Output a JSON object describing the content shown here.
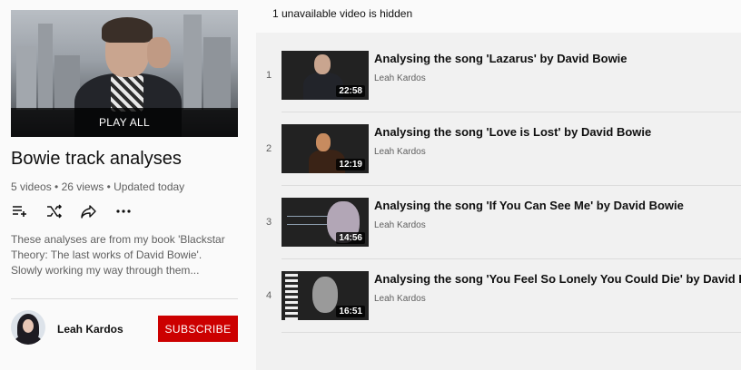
{
  "playlist": {
    "play_all_label": "PLAY ALL",
    "title": "Bowie track analyses",
    "meta": "5 videos • 26 views • Updated today",
    "description": "These analyses are from my book 'Blackstar Theory: The last works of David Bowie'. Slowly working my way through them...",
    "actions": [
      {
        "icon": "add-to-queue-icon"
      },
      {
        "icon": "shuffle-icon"
      },
      {
        "icon": "share-icon"
      },
      {
        "icon": "more-icon"
      }
    ]
  },
  "owner": {
    "name": "Leah Kardos",
    "subscribe_label": "SUBSCRIBE"
  },
  "notice": {
    "hidden_text": "1 unavailable video is hidden"
  },
  "videos": [
    {
      "index": "1",
      "title": "Analysing the song 'Lazarus' by David Bowie",
      "channel": "Leah Kardos",
      "duration": "22:58"
    },
    {
      "index": "2",
      "title": "Analysing the song 'Love is Lost' by David Bowie",
      "channel": "Leah Kardos",
      "duration": "12:19"
    },
    {
      "index": "3",
      "title": "Analysing the song 'If You Can See Me' by David Bowie",
      "channel": "Leah Kardos",
      "duration": "14:56"
    },
    {
      "index": "4",
      "title": "Analysing the song 'You Feel So Lonely You Could Die' by David Bowie",
      "channel": "Leah Kardos",
      "duration": "16:51"
    }
  ],
  "colors": {
    "subscribe_bg": "#cc0000",
    "page_bg": "#f1f1f1",
    "sidebar_bg": "#fafafa",
    "meta_text": "#606060"
  }
}
